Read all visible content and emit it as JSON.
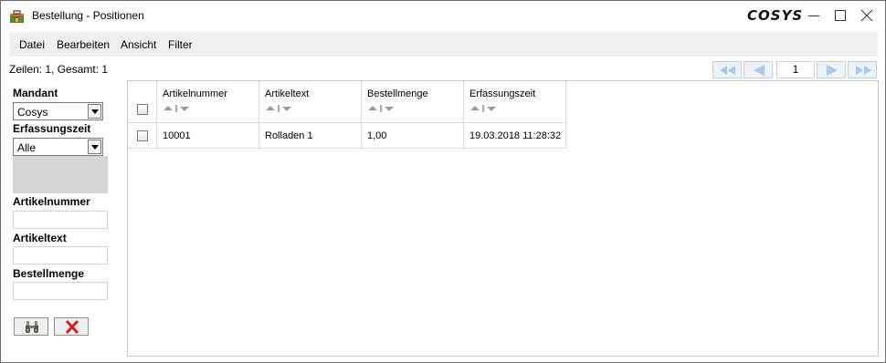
{
  "window": {
    "title": "Bestellung - Positionen",
    "brand": "COSYS"
  },
  "menu": {
    "items": [
      "Datei",
      "Bearbeiten",
      "Ansicht",
      "Filter"
    ]
  },
  "status": {
    "rows_text": "Zeilen: 1, Gesamt: 1"
  },
  "pager": {
    "page": "1"
  },
  "filters": {
    "mandant_label": "Mandant",
    "mandant_value": "Cosys",
    "erfassungszeit_label": "Erfassungszeit",
    "erfassungszeit_value": "Alle",
    "artikelnummer_label": "Artikelnummer",
    "artikeltext_label": "Artikeltext",
    "bestellmenge_label": "Bestellmenge"
  },
  "grid": {
    "columns": [
      "Artikelnummer",
      "Artikeltext",
      "Bestellmenge",
      "Erfassungszeit"
    ],
    "rows": [
      [
        "10001",
        "Rolladen 1",
        "1,00",
        "19.03.2018 11:28:32"
      ]
    ]
  },
  "colors": {
    "pager_arrow": "#a9c6ee",
    "cancel_red": "#d42020"
  },
  "icons": {
    "app": "toolbox-icon",
    "search": "binoculars-icon",
    "clear": "red-x-icon"
  }
}
